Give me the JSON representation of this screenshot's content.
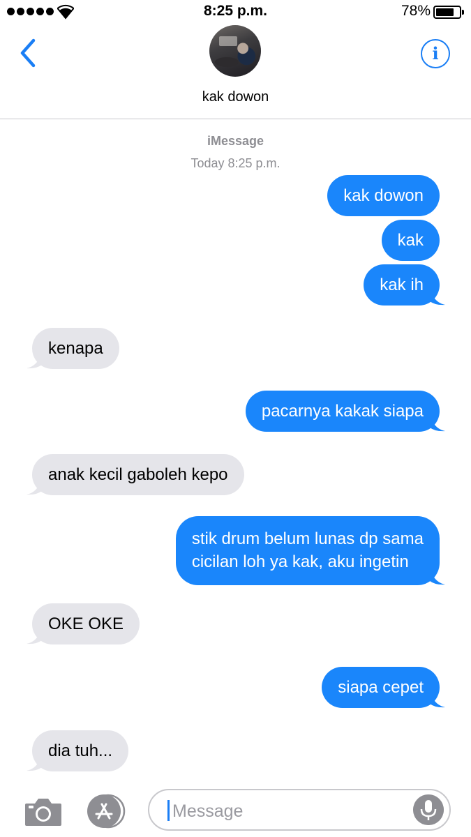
{
  "status_bar": {
    "time": "8:25 p.m.",
    "battery_percent": "78%",
    "battery_level": 0.78,
    "signal_bars": 5
  },
  "header": {
    "contact_name": "kak dowon",
    "info_glyph": "i",
    "icons": {
      "back": "chevron-left-icon",
      "info": "info-icon"
    }
  },
  "thread": {
    "service_label": "iMessage",
    "timestamp": "Today 8:25 p.m.",
    "messages": [
      {
        "direction": "sent",
        "lines": [
          "kak dowon"
        ]
      },
      {
        "direction": "sent",
        "lines": [
          "kak"
        ]
      },
      {
        "direction": "sent",
        "lines": [
          "kak ih"
        ]
      },
      {
        "direction": "received",
        "lines": [
          "kenapa"
        ]
      },
      {
        "direction": "sent",
        "lines": [
          "pacarnya kakak siapa"
        ]
      },
      {
        "direction": "received",
        "lines": [
          "anak kecil gaboleh kepo"
        ]
      },
      {
        "direction": "sent",
        "lines": [
          "stik drum belum lunas dp sama",
          "cicilan loh ya kak, aku ingetin"
        ]
      },
      {
        "direction": "received",
        "lines": [
          "OKE OKE"
        ]
      },
      {
        "direction": "sent",
        "lines": [
          "siapa cepet"
        ]
      },
      {
        "direction": "received",
        "lines": [
          "dia tuh..."
        ]
      }
    ]
  },
  "input_bar": {
    "placeholder": "Message",
    "icons": {
      "camera": "camera-icon",
      "apps": "app-store-icon",
      "mic": "microphone-icon"
    }
  },
  "colors": {
    "sent_bubble": "#1a86fb",
    "received_bubble": "#e5e5ea",
    "accent": "#1a7ef5",
    "meta_text": "#8e8e93"
  }
}
